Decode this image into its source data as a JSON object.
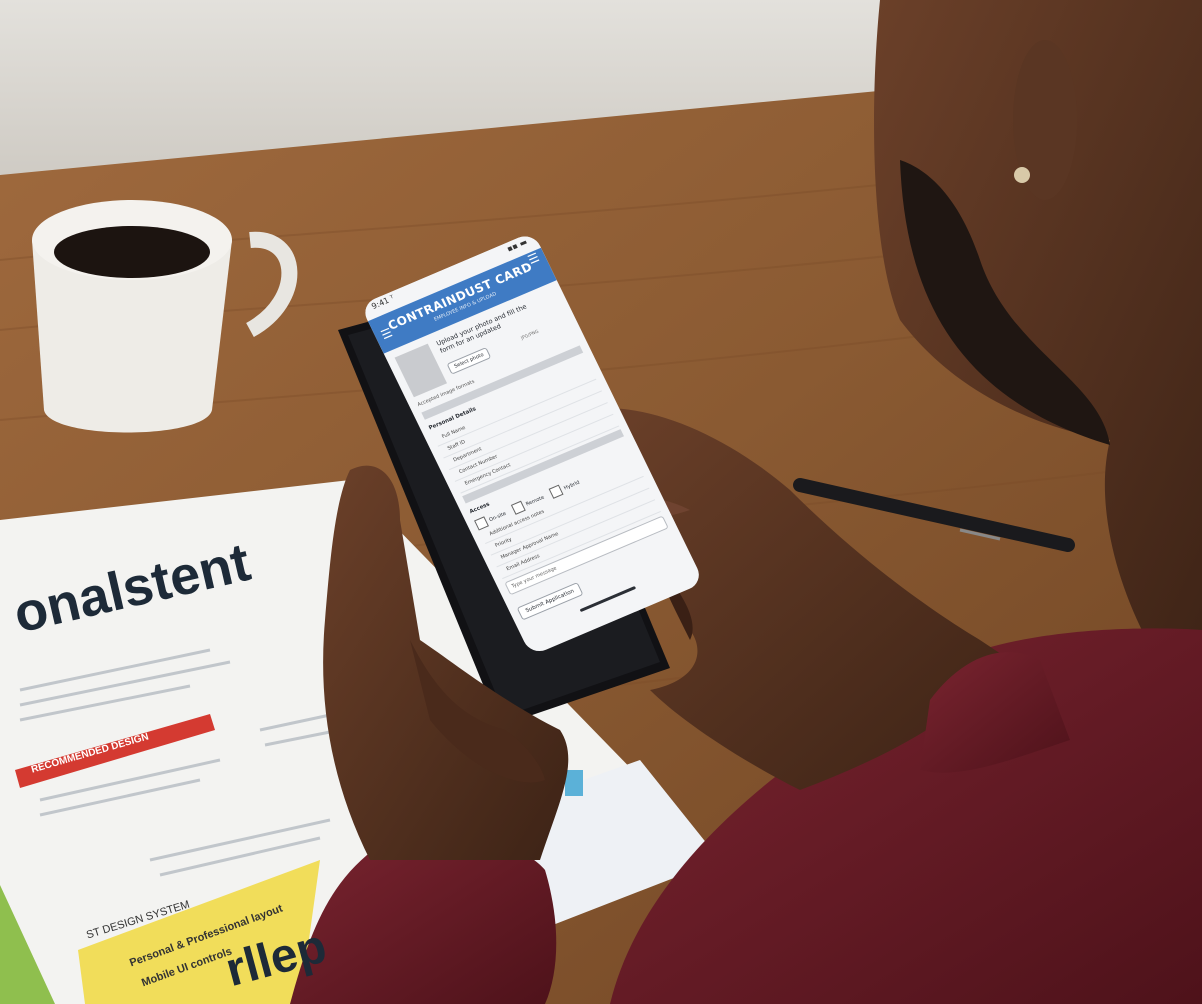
{
  "phone": {
    "status_left": "9:41 ᵀ",
    "status_right": "▪▪ ▬",
    "app_title": "CONTRAINDUST CARD",
    "app_subtitle": "EMPLOYEE INFO & UPLOAD",
    "upload_text_line1": "Upload your photo and fill the",
    "upload_text_line2": "form for an updated",
    "upload_button": "Select photo",
    "upload_meta": "JPG/PNG",
    "caption": "Accepted image formats",
    "section_1": "Personal Details",
    "rows": [
      "Full Name",
      "Staff ID",
      "Department",
      "Contact Number",
      "Emergency Contact"
    ],
    "section_2": "Access",
    "checks": [
      "On-site",
      "Remote",
      "Hybrid"
    ],
    "sub_label_1": "Additional access notes",
    "sub_label_2": "Priority",
    "sub_label_3": "Manager Approval Name",
    "sub_label_4": "Email Address",
    "field_placeholder": "Type your message",
    "submit_button": "Submit Application"
  },
  "paper": {
    "headline": "onalstent",
    "bottom_word": "rllep",
    "red_banner": "RECOMMENDED DESIGN",
    "yellow_text_1": "Personal & Professional layout",
    "yellow_text_2": "Mobile UI controls",
    "code_label": "ST DESIGN SYSTEM"
  },
  "colors": {
    "appbar": "#3f7bc4",
    "table": "#8a5a32",
    "sweater": "#6b1d26",
    "skin": "#5a3623",
    "red_banner": "#d43a31",
    "yellow": "#f1dd5a",
    "green": "#8fbf4e"
  }
}
